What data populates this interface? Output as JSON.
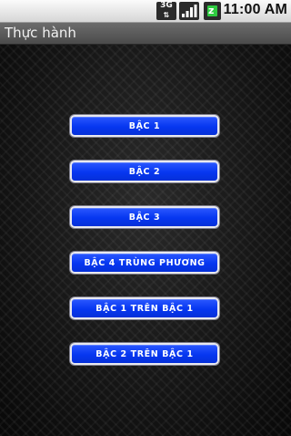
{
  "status_bar": {
    "network_label": "3G",
    "network_arrows": "⇅",
    "clock": "11:00 AM",
    "icons": [
      "network-3g-icon",
      "signal-icon",
      "battery-icon"
    ]
  },
  "app_bar": {
    "title": "Thực hành"
  },
  "buttons": [
    {
      "label": "BẬC 1"
    },
    {
      "label": "BẬC 2"
    },
    {
      "label": "BẬC 3"
    },
    {
      "label": "BẬC 4 TRÙNG PHƯƠNG"
    },
    {
      "label": "BẬC 1 TRÊN BẬC 1"
    },
    {
      "label": "BẬC 2 TRÊN BẬC 1"
    }
  ],
  "colors": {
    "button_fill": "#0636f0",
    "button_border": "#e9e9ef",
    "background": "#0c0c0c"
  }
}
